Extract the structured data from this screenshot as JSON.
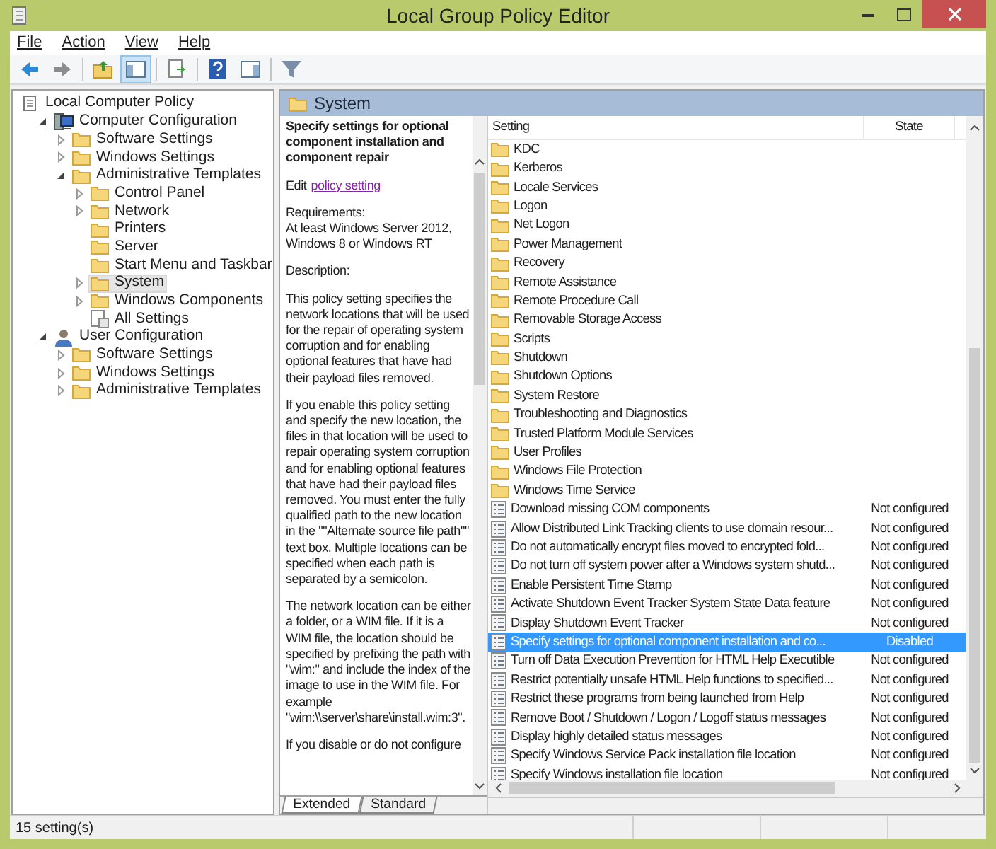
{
  "window": {
    "title": "Local Group Policy Editor"
  },
  "menu": [
    {
      "label": "File"
    },
    {
      "label": "Action"
    },
    {
      "label": "View"
    },
    {
      "label": "Help"
    }
  ],
  "toolbar": [
    {
      "kind": "back",
      "pressed": false
    },
    {
      "kind": "forward",
      "pressed": false
    },
    {
      "kind": "sep"
    },
    {
      "kind": "up",
      "pressed": false
    },
    {
      "kind": "tree",
      "pressed": true
    },
    {
      "kind": "sep"
    },
    {
      "kind": "export",
      "pressed": false
    },
    {
      "kind": "sep"
    },
    {
      "kind": "help",
      "pressed": false
    },
    {
      "kind": "pane",
      "pressed": false
    },
    {
      "kind": "sep"
    },
    {
      "kind": "filter",
      "pressed": false
    }
  ],
  "tree": [
    {
      "label": "Local Computer Policy",
      "kind": "policy",
      "selected": false,
      "children": [
        {
          "label": "Computer Configuration",
          "kind": "computer",
          "expanded": true,
          "selected": false,
          "children": [
            {
              "label": "Software Settings",
              "kind": "folder",
              "expanded": false,
              "selected": false
            },
            {
              "label": "Windows Settings",
              "kind": "folder",
              "expanded": false,
              "selected": false
            },
            {
              "label": "Administrative Templates",
              "kind": "folder",
              "expanded": true,
              "selected": false,
              "children": [
                {
                  "label": "Control Panel",
                  "kind": "folder",
                  "expanded": false,
                  "selected": false
                },
                {
                  "label": "Network",
                  "kind": "folder",
                  "expanded": false,
                  "selected": false
                },
                {
                  "label": "Printers",
                  "kind": "folder",
                  "selected": false
                },
                {
                  "label": "Server",
                  "kind": "folder",
                  "selected": false
                },
                {
                  "label": "Start Menu and Taskbar",
                  "kind": "folder",
                  "selected": false
                },
                {
                  "label": "System",
                  "kind": "folder",
                  "expanded": false,
                  "selected": true
                },
                {
                  "label": "Windows Components",
                  "kind": "folder",
                  "expanded": false,
                  "selected": false
                },
                {
                  "label": "All Settings",
                  "kind": "settings",
                  "selected": false
                }
              ]
            }
          ]
        },
        {
          "label": "User Configuration",
          "kind": "user",
          "expanded": true,
          "selected": false,
          "children": [
            {
              "label": "Software Settings",
              "kind": "folder",
              "expanded": false,
              "selected": false
            },
            {
              "label": "Windows Settings",
              "kind": "folder",
              "expanded": false,
              "selected": false
            },
            {
              "label": "Administrative Templates",
              "kind": "folder",
              "expanded": false,
              "selected": false
            }
          ]
        }
      ]
    }
  ],
  "header": {
    "title": "System"
  },
  "description": {
    "title": "Specify settings for optional component installation and component repair",
    "edit_prefix": "Edit",
    "edit_link": "policy setting",
    "paragraphs": [
      "Requirements:\nAt least Windows Server 2012, Windows 8 or Windows RT",
      "Description:",
      "This policy setting specifies the network locations that will be used for the repair of operating system corruption and for enabling optional features that have had their payload files removed.",
      "If you enable this policy setting and specify the new location, the files in that location will be used to repair operating system corruption and for enabling optional features that have had their payload files removed. You must enter the fully qualified path to the new location in the \"\"Alternate source file path\"\" text box. Multiple locations can be specified when each path is separated by a semicolon.",
      "The network location can be either a folder, or a WIM file. If it is a WIM file, the location should be specified by prefixing the path with \"wim:\" and include the index of the image to use in the WIM file. For example \"wim:\\\\server\\share\\install.wim:3\".",
      "If you disable or do not configure"
    ],
    "tabs": [
      {
        "label": "Extended",
        "selected": true
      },
      {
        "label": "Standard",
        "selected": false
      }
    ]
  },
  "list": {
    "columns": [
      "Setting",
      "State"
    ],
    "rows": [
      {
        "kind": "folder",
        "name": "KDC",
        "selected": false
      },
      {
        "kind": "folder",
        "name": "Kerberos",
        "selected": false
      },
      {
        "kind": "folder",
        "name": "Locale Services",
        "selected": false
      },
      {
        "kind": "folder",
        "name": "Logon",
        "selected": false
      },
      {
        "kind": "folder",
        "name": "Net Logon",
        "selected": false
      },
      {
        "kind": "folder",
        "name": "Power Management",
        "selected": false
      },
      {
        "kind": "folder",
        "name": "Recovery",
        "selected": false
      },
      {
        "kind": "folder",
        "name": "Remote Assistance",
        "selected": false
      },
      {
        "kind": "folder",
        "name": "Remote Procedure Call",
        "selected": false
      },
      {
        "kind": "folder",
        "name": "Removable Storage Access",
        "selected": false
      },
      {
        "kind": "folder",
        "name": "Scripts",
        "selected": false
      },
      {
        "kind": "folder",
        "name": "Shutdown",
        "selected": false
      },
      {
        "kind": "folder",
        "name": "Shutdown Options",
        "selected": false
      },
      {
        "kind": "folder",
        "name": "System Restore",
        "selected": false
      },
      {
        "kind": "folder",
        "name": "Troubleshooting and Diagnostics",
        "selected": false
      },
      {
        "kind": "folder",
        "name": "Trusted Platform Module Services",
        "selected": false
      },
      {
        "kind": "folder",
        "name": "User Profiles",
        "selected": false
      },
      {
        "kind": "folder",
        "name": "Windows File Protection",
        "selected": false
      },
      {
        "kind": "folder",
        "name": "Windows Time Service",
        "selected": false
      },
      {
        "kind": "policy",
        "name": "Download missing COM components",
        "state": "Not configured",
        "selected": false
      },
      {
        "kind": "policy",
        "name": "Allow Distributed Link Tracking clients to use domain resour...",
        "state": "Not configured",
        "selected": false
      },
      {
        "kind": "policy",
        "name": "Do not automatically encrypt files moved to encrypted fold...",
        "state": "Not configured",
        "selected": false
      },
      {
        "kind": "policy",
        "name": "Do not turn off system power after a Windows system shutd...",
        "state": "Not configured",
        "selected": false
      },
      {
        "kind": "policy",
        "name": "Enable Persistent Time Stamp",
        "state": "Not configured",
        "selected": false
      },
      {
        "kind": "policy",
        "name": "Activate Shutdown Event Tracker System State Data feature",
        "state": "Not configured",
        "selected": false
      },
      {
        "kind": "policy",
        "name": "Display Shutdown Event Tracker",
        "state": "Not configured",
        "selected": false
      },
      {
        "kind": "policy",
        "name": "Specify settings for optional component installation and co...",
        "state": "Disabled",
        "selected": true
      },
      {
        "kind": "policy",
        "name": "Turn off Data Execution Prevention for HTML Help Executible",
        "state": "Not configured",
        "selected": false
      },
      {
        "kind": "policy",
        "name": "Restrict potentially unsafe HTML Help functions to specified...",
        "state": "Not configured",
        "selected": false
      },
      {
        "kind": "policy",
        "name": "Restrict these programs from being launched from Help",
        "state": "Not configured",
        "selected": false
      },
      {
        "kind": "policy",
        "name": "Remove Boot / Shutdown / Logon / Logoff status messages",
        "state": "Not configured",
        "selected": false
      },
      {
        "kind": "policy",
        "name": "Display highly detailed status messages",
        "state": "Not configured",
        "selected": false
      },
      {
        "kind": "policy",
        "name": "Specify Windows Service Pack installation file location",
        "state": "Not configured",
        "selected": false
      },
      {
        "kind": "policy",
        "name": "Specify Windows installation file location",
        "state": "Not configured",
        "selected": false
      }
    ]
  },
  "status_bar": {
    "text": "15 setting(s)"
  }
}
